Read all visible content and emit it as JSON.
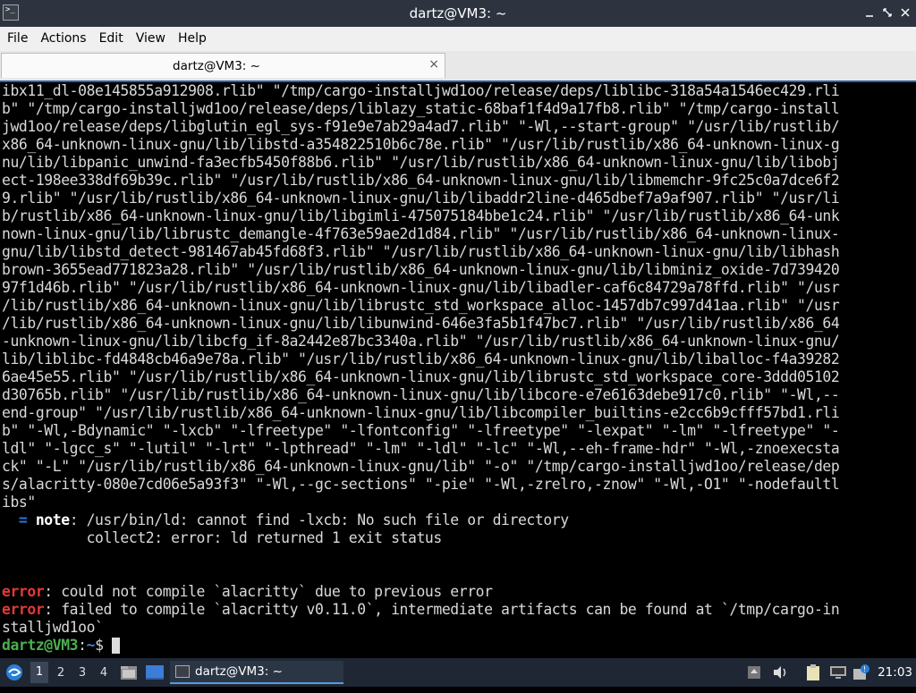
{
  "window": {
    "title": "dartz@VM3: ~",
    "icon": "terminal-icon"
  },
  "menu": [
    "File",
    "Actions",
    "Edit",
    "View",
    "Help"
  ],
  "tab": {
    "label": "dartz@VM3: ~",
    "close": "×"
  },
  "terminal": {
    "lines": [
      "ibx11_dl-08e145855a912908.rlib\" \"/tmp/cargo-installjwd1oo/release/deps/liblibc-318a54a1546ec429.rli",
      "b\" \"/tmp/cargo-installjwd1oo/release/deps/liblazy_static-68baf1f4d9a17fb8.rlib\" \"/tmp/cargo-install",
      "jwd1oo/release/deps/libglutin_egl_sys-f91e9e7ab29a4ad7.rlib\" \"-Wl,--start-group\" \"/usr/lib/rustlib/",
      "x86_64-unknown-linux-gnu/lib/libstd-a354822510b6c78e.rlib\" \"/usr/lib/rustlib/x86_64-unknown-linux-g",
      "nu/lib/libpanic_unwind-fa3ecfb5450f88b6.rlib\" \"/usr/lib/rustlib/x86_64-unknown-linux-gnu/lib/libobj",
      "ect-198ee338df69b39c.rlib\" \"/usr/lib/rustlib/x86_64-unknown-linux-gnu/lib/libmemchr-9fc25c0a7dce6f2",
      "9.rlib\" \"/usr/lib/rustlib/x86_64-unknown-linux-gnu/lib/libaddr2line-d465dbef7a9af907.rlib\" \"/usr/li",
      "b/rustlib/x86_64-unknown-linux-gnu/lib/libgimli-475075184bbe1c24.rlib\" \"/usr/lib/rustlib/x86_64-unk",
      "nown-linux-gnu/lib/librustc_demangle-4f763e59ae2d1d84.rlib\" \"/usr/lib/rustlib/x86_64-unknown-linux-",
      "gnu/lib/libstd_detect-981467ab45fd68f3.rlib\" \"/usr/lib/rustlib/x86_64-unknown-linux-gnu/lib/libhash",
      "brown-3655ead771823a28.rlib\" \"/usr/lib/rustlib/x86_64-unknown-linux-gnu/lib/libminiz_oxide-7d739420",
      "97f1d46b.rlib\" \"/usr/lib/rustlib/x86_64-unknown-linux-gnu/lib/libadler-caf6c84729a78ffd.rlib\" \"/usr",
      "/lib/rustlib/x86_64-unknown-linux-gnu/lib/librustc_std_workspace_alloc-1457db7c997d41aa.rlib\" \"/usr",
      "/lib/rustlib/x86_64-unknown-linux-gnu/lib/libunwind-646e3fa5b1f47bc7.rlib\" \"/usr/lib/rustlib/x86_64",
      "-unknown-linux-gnu/lib/libcfg_if-8a2442e87bc3340a.rlib\" \"/usr/lib/rustlib/x86_64-unknown-linux-gnu/",
      "lib/liblibc-fd4848cb46a9e78a.rlib\" \"/usr/lib/rustlib/x86_64-unknown-linux-gnu/lib/liballoc-f4a39282",
      "6ae45e55.rlib\" \"/usr/lib/rustlib/x86_64-unknown-linux-gnu/lib/librustc_std_workspace_core-3ddd05102",
      "d30765b.rlib\" \"/usr/lib/rustlib/x86_64-unknown-linux-gnu/lib/libcore-e7e6163debe917c0.rlib\" \"-Wl,--",
      "end-group\" \"/usr/lib/rustlib/x86_64-unknown-linux-gnu/lib/libcompiler_builtins-e2cc6b9cfff57bd1.rli",
      "b\" \"-Wl,-Bdynamic\" \"-lxcb\" \"-lfreetype\" \"-lfontconfig\" \"-lfreetype\" \"-lexpat\" \"-lm\" \"-lfreetype\" \"-",
      "ldl\" \"-lgcc_s\" \"-lutil\" \"-lrt\" \"-lpthread\" \"-lm\" \"-ldl\" \"-lc\" \"-Wl,--eh-frame-hdr\" \"-Wl,-znoexecsta",
      "ck\" \"-L\" \"/usr/lib/rustlib/x86_64-unknown-linux-gnu/lib\" \"-o\" \"/tmp/cargo-installjwd1oo/release/dep",
      "s/alacritty-080e7cd06e5a93f3\" \"-Wl,--gc-sections\" \"-pie\" \"-Wl,-zrelro,-znow\" \"-Wl,-O1\" \"-nodefaultl",
      "ibs\""
    ],
    "note": {
      "prefix": "  = ",
      "keyword": "note",
      "text": ": /usr/bin/ld: cannot find -lxcb: No such file or directory"
    },
    "collect_line": "          collect2: error: ld returned 1 exit status",
    "errors": [
      {
        "keyword": "error",
        "text": ": could not compile `alacritty` due to previous error"
      },
      {
        "keyword": "error",
        "text": ": failed to compile `alacritty v0.11.0`, intermediate artifacts can be found at `/tmp/cargo-in"
      }
    ],
    "wrap_line": "stalljwd1oo`",
    "prompt": {
      "user": "dartz@VM3",
      "sep": ":",
      "path": "~",
      "symbol": "$ "
    }
  },
  "taskbar": {
    "workspaces": [
      "1",
      "2",
      "3",
      "4"
    ],
    "active_workspace": "1",
    "task_label": "dartz@VM3: ~",
    "clock": "21:03"
  }
}
